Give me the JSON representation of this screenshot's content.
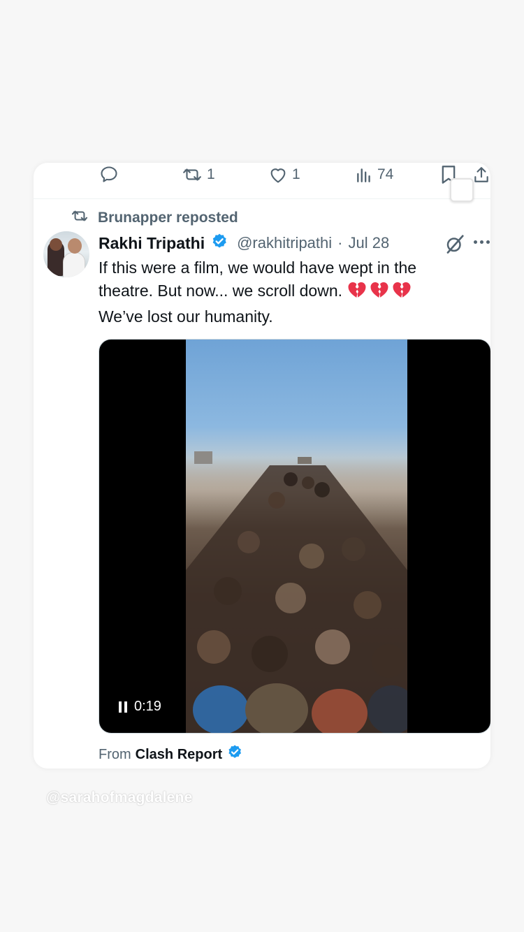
{
  "action_bar": {
    "retweet_count": "1",
    "like_count": "1",
    "views_count": "74"
  },
  "repost": {
    "text": "Brunapper reposted"
  },
  "tweet": {
    "author_name": "Rakhi Tripathi",
    "handle": "@rakhitripathi",
    "separator": "·",
    "date": "Jul 28",
    "text_line1": "If this were a film, we would have wept in the",
    "text_line2": "theatre. But now... we scroll down.",
    "text_line3": "We’ve lost our humanity.",
    "emoji": "broken-heart-icon ×3"
  },
  "video": {
    "elapsed": "0:19",
    "state": "playing"
  },
  "source": {
    "prefix": "From",
    "name": "Clash Report"
  },
  "watermark": "@sarahofmagdalene",
  "colors": {
    "verified": "#1d9bf0",
    "secondary_text": "#536471",
    "primary_text": "#0f1419",
    "broken_heart": "#e8334a"
  }
}
